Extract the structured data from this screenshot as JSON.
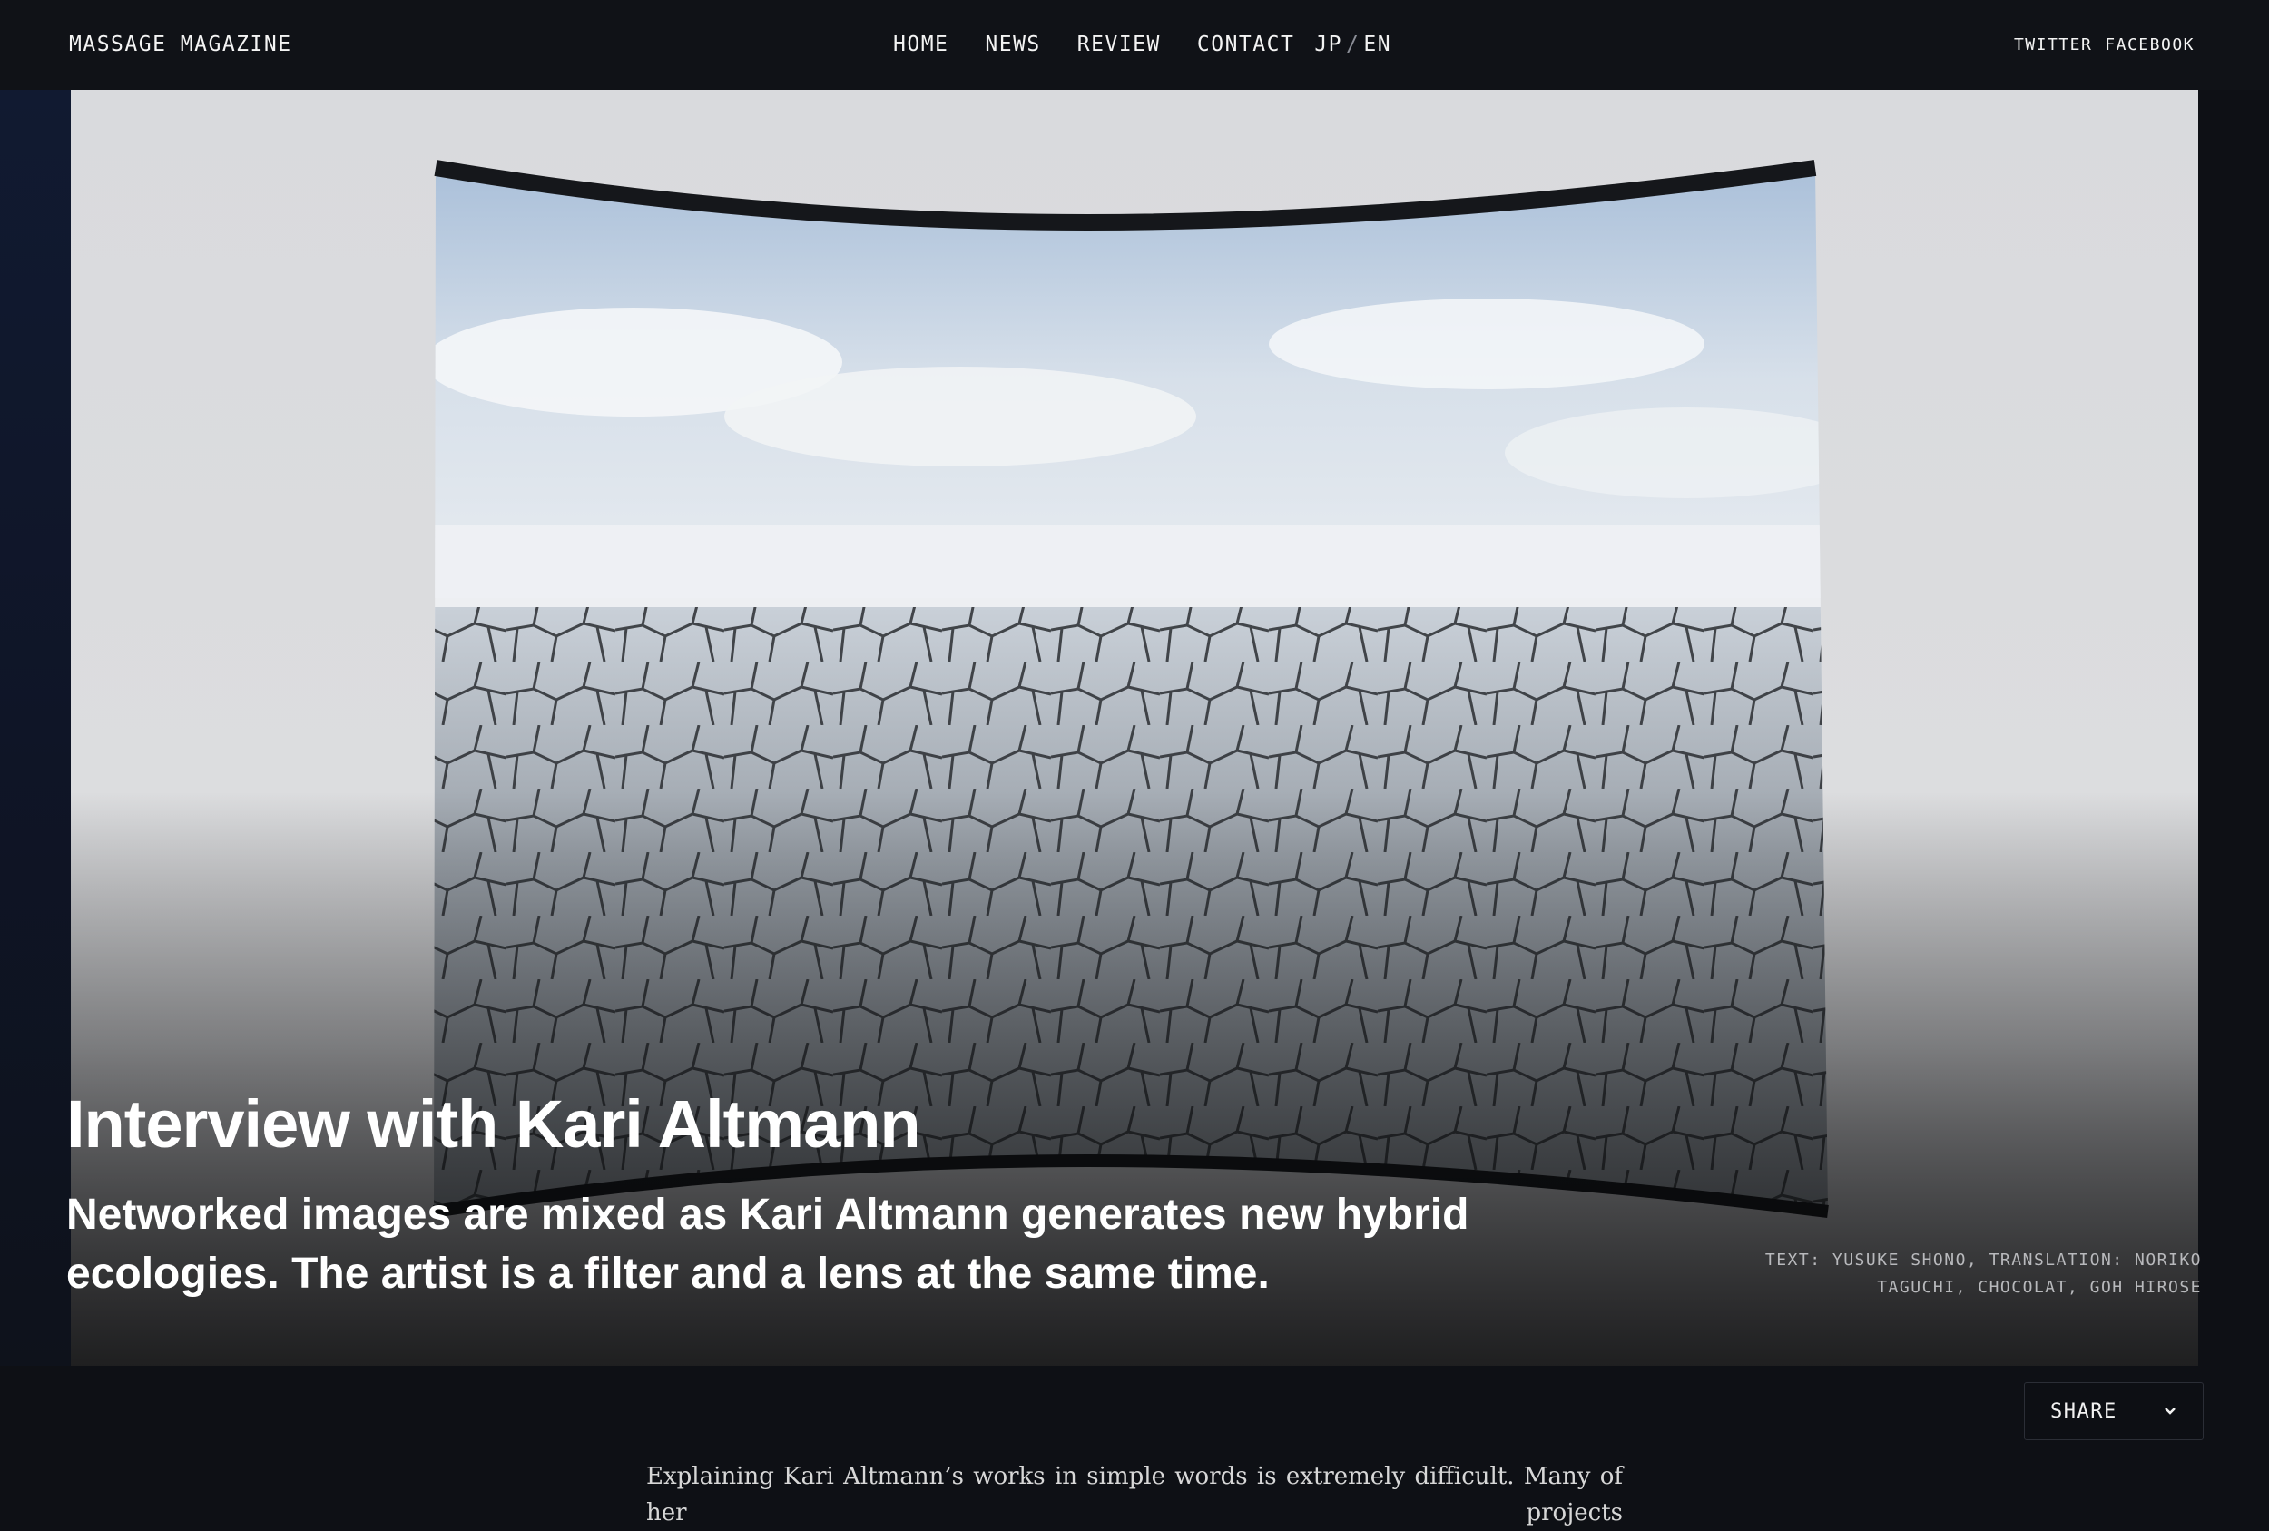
{
  "header": {
    "brand": "MASSAGE MAGAZINE",
    "nav": [
      "HOME",
      "NEWS",
      "REVIEW",
      "CONTACT"
    ],
    "lang": {
      "jp": "JP",
      "separator": "/",
      "en": "EN"
    },
    "social": [
      "TWITTER",
      "FACEBOOK"
    ]
  },
  "article": {
    "title": "Interview with Kari Altmann",
    "lead": "Networked images are mixed as Kari Altmann generates new hybrid ecologies. The artist is a filter and a lens at the same time.",
    "credits_line1": "TEXT: YUSUKE SHONO, TRANSLATION: NORIKO",
    "credits_line2": "TAGUCHI, CHOCOLAT, GOH HIROSE",
    "share_label": "SHARE",
    "body_first_line": "Explaining Kari Altmann’s works in simple words is extremely difficult. Many of her projects"
  },
  "colors": {
    "bar": "#101217",
    "accent_text": "#ffffff"
  }
}
